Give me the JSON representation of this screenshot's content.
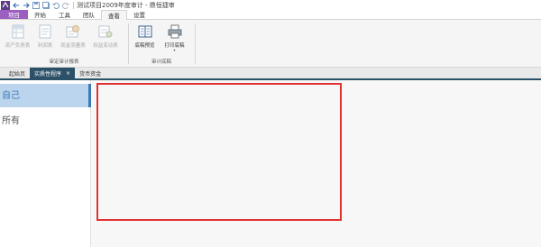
{
  "titlebar": {
    "title": "测试项目2009年度审计 - 鼎恒捷审"
  },
  "ribbon_tabs": [
    {
      "label": "项目"
    },
    {
      "label": "开始"
    },
    {
      "label": "工具"
    },
    {
      "label": "团队"
    },
    {
      "label": "查看"
    },
    {
      "label": "设置"
    }
  ],
  "ribbon": {
    "group1": {
      "label": "审定审计报表",
      "buttons": [
        {
          "label": "资产负债表",
          "icon": "balance-sheet-icon",
          "enabled": false
        },
        {
          "label": "利润表",
          "icon": "income-statement-icon",
          "enabled": false
        },
        {
          "label": "现金流量表",
          "icon": "cash-flow-icon",
          "enabled": false
        },
        {
          "label": "权益变动表",
          "icon": "equity-change-icon",
          "enabled": false
        }
      ]
    },
    "group2": {
      "label": "审计底稿",
      "buttons": [
        {
          "label": "底稿预览",
          "icon": "preview-icon",
          "enabled": true
        },
        {
          "label": "打印底稿",
          "icon": "printer-icon",
          "enabled": true,
          "dropdown": "▾"
        }
      ]
    }
  },
  "doc_tabs": [
    {
      "label": "起始页"
    },
    {
      "label": "实质性程序",
      "close": "×"
    },
    {
      "label": "货币资金"
    }
  ],
  "left_panel": {
    "items": [
      {
        "label": "自己"
      },
      {
        "label": "所有"
      }
    ]
  },
  "colors": {
    "app_tab": "#9b5fc0",
    "active_doc_tab": "#2c5068",
    "selection_highlight": "#bcd5ee",
    "selection_border": "#e03232"
  }
}
